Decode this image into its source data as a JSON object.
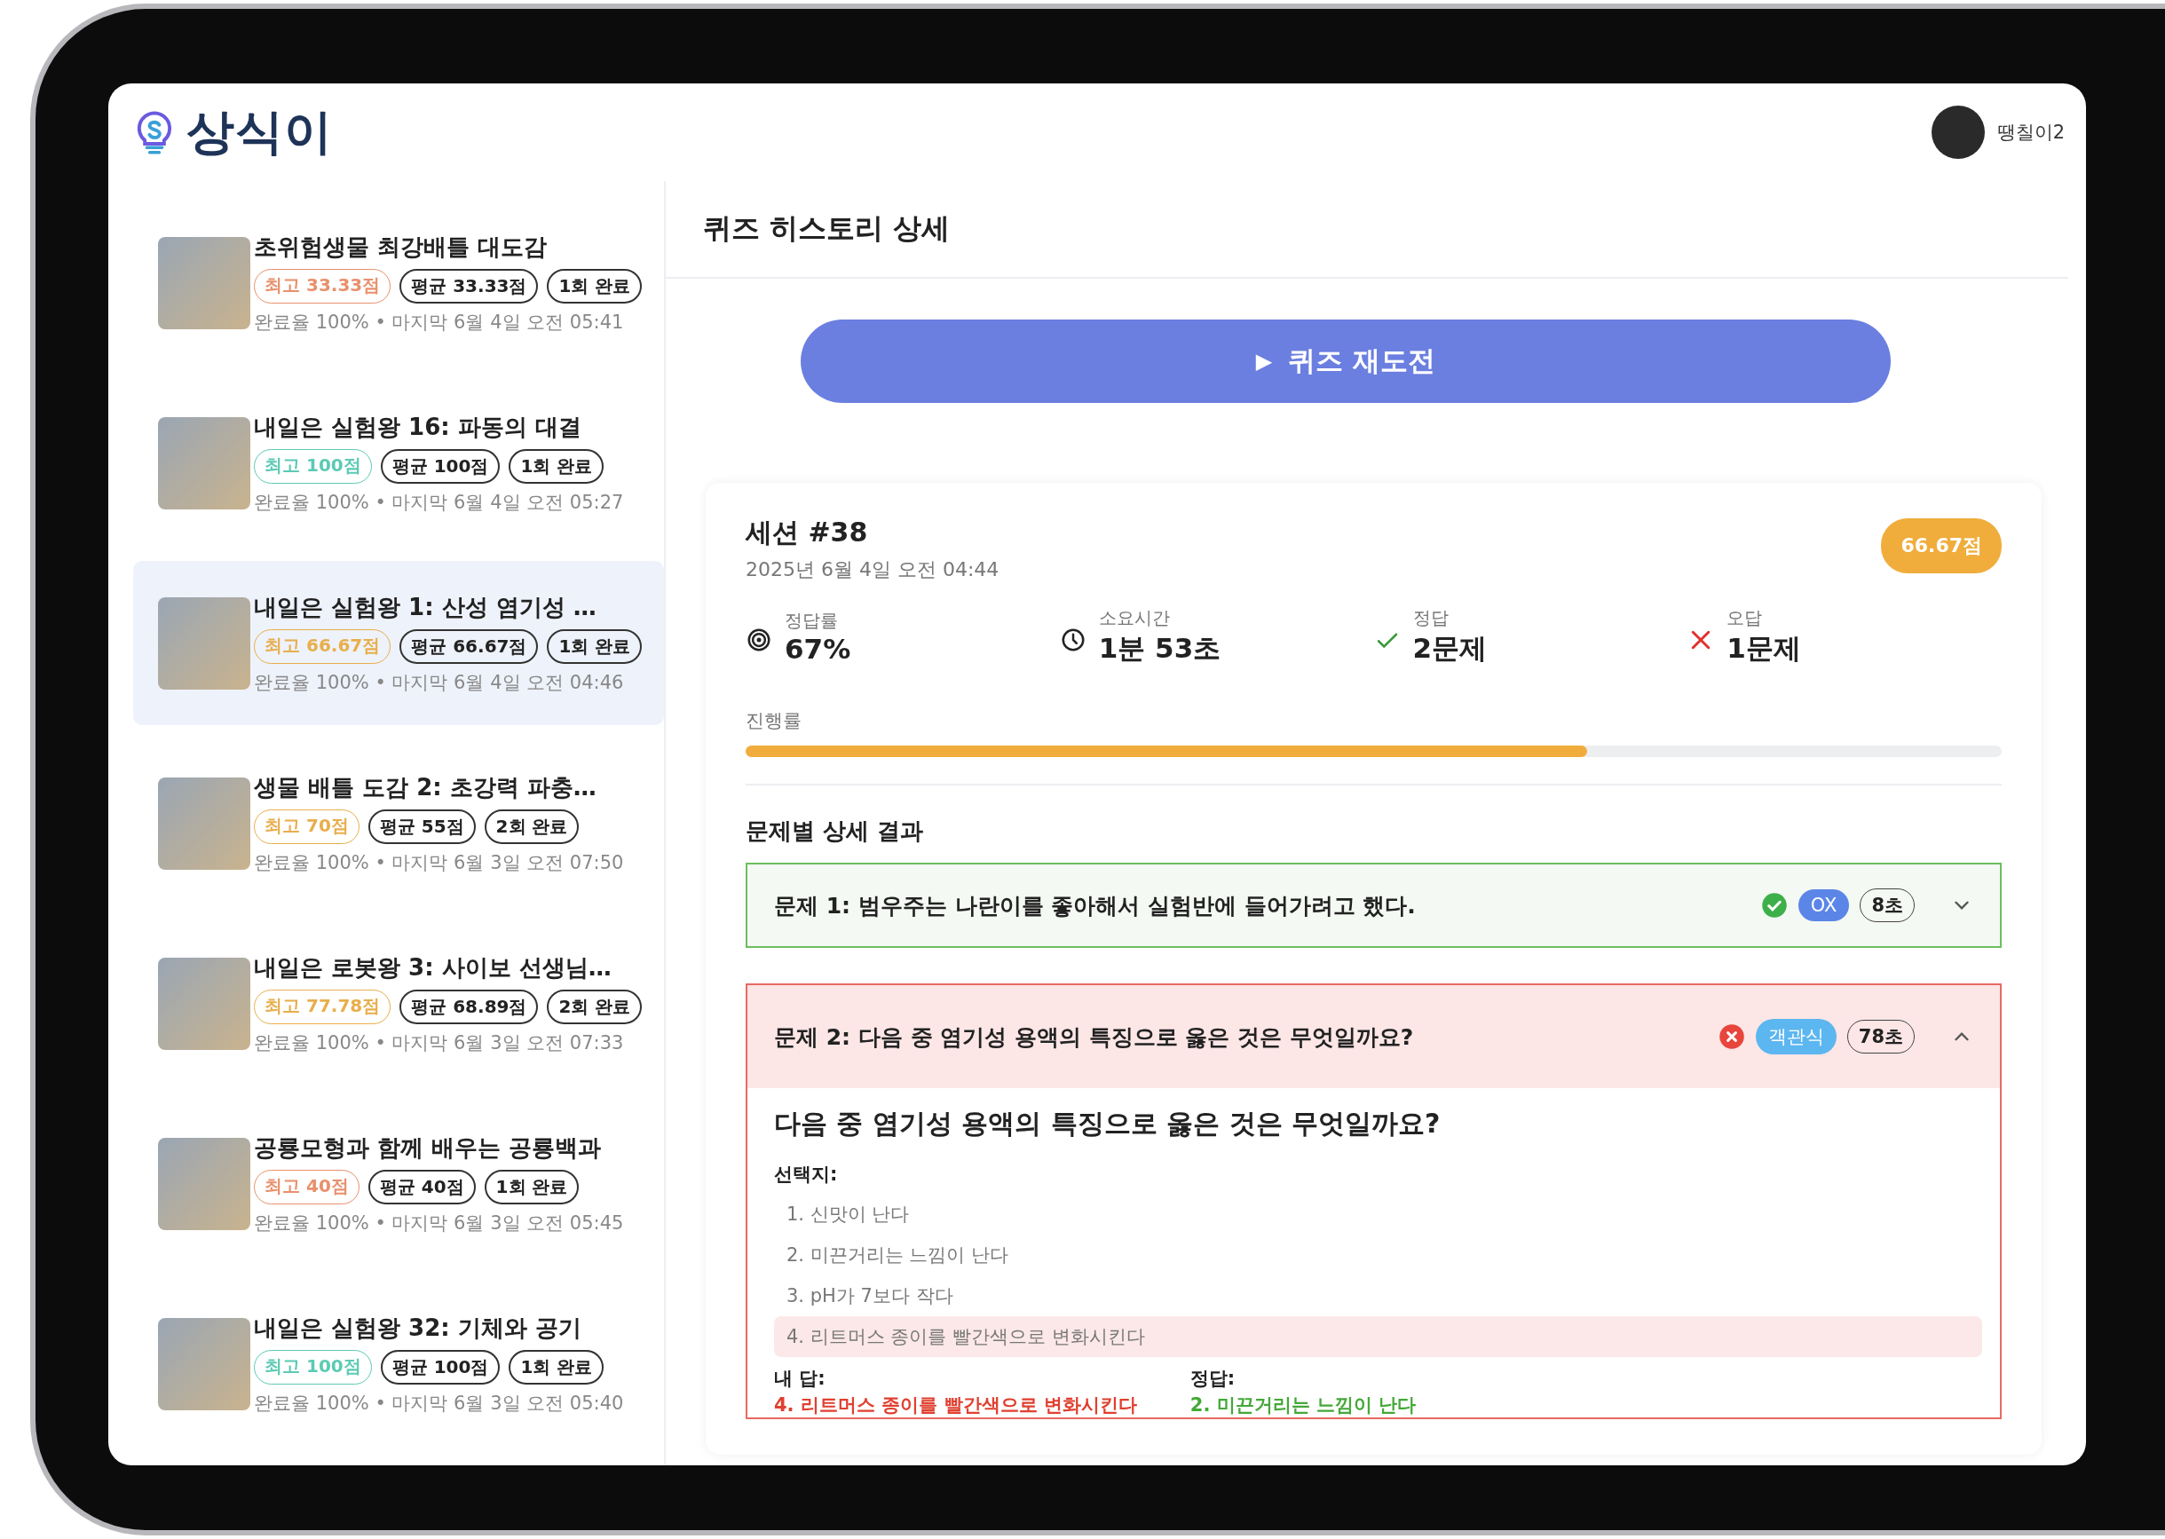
{
  "app": {
    "logo_text": "상식이",
    "user_name": "땡칠이2"
  },
  "sidebar": {
    "items": [
      {
        "title": "초위험생물 최강배틀 대도감",
        "best": {
          "text": "최고 33.33점",
          "color": "#e8906c"
        },
        "average": "평균 33.33점",
        "count": "1회 완료",
        "meta": "완료율 100% • 마지막 6월 4일 오전 05:41",
        "selected": false
      },
      {
        "title": "내일은 실험왕 16: 파동의 대결",
        "best": {
          "text": "최고 100점",
          "color": "#5ccab4"
        },
        "average": "평균 100점",
        "count": "1회 완료",
        "meta": "완료율 100% • 마지막 6월 4일 오전 05:27",
        "selected": false
      },
      {
        "title": "내일은 실험왕 1: 산성 염기성 …",
        "best": {
          "text": "최고 66.67점",
          "color": "#e8ae4c"
        },
        "average": "평균 66.67점",
        "count": "1회 완료",
        "meta": "완료율 100% • 마지막 6월 4일 오전 04:46",
        "selected": true
      },
      {
        "title": "생물 배틀 도감 2: 초강력 파충…",
        "best": {
          "text": "최고 70점",
          "color": "#e8ae4c"
        },
        "average": "평균 55점",
        "count": "2회 완료",
        "meta": "완료율 100% • 마지막 6월 3일 오전 07:50",
        "selected": false
      },
      {
        "title": "내일은 로봇왕 3: 사이보 선생님…",
        "best": {
          "text": "최고 77.78점",
          "color": "#e8ae4c"
        },
        "average": "평균 68.89점",
        "count": "2회 완료",
        "meta": "완료율 100% • 마지막 6월 3일 오전 07:33",
        "selected": false
      },
      {
        "title": "공룡모형과 함께 배우는 공룡백과",
        "best": {
          "text": "최고 40점",
          "color": "#e8906c"
        },
        "average": "평균 40점",
        "count": "1회 완료",
        "meta": "완료율 100% • 마지막 6월 3일 오전 05:45",
        "selected": false
      },
      {
        "title": "내일은 실험왕 32: 기체와 공기",
        "best": {
          "text": "최고 100점",
          "color": "#5ccab4"
        },
        "average": "평균 100점",
        "count": "1회 완료",
        "meta": "완료율 100% • 마지막 6월 3일 오전 05:40",
        "selected": false
      }
    ]
  },
  "main": {
    "title": "퀴즈 히스토리 상세",
    "retry_button": {
      "icon": "▶",
      "label": "퀴즈 재도전"
    },
    "session": {
      "title": "세션 #38",
      "date": "2025년 6월 4일 오전 04:44",
      "score": "66.67점",
      "stats": [
        {
          "kind": "accuracy",
          "label": "정답률",
          "value": "67%"
        },
        {
          "kind": "time",
          "label": "소요시간",
          "value": "1분 53초"
        },
        {
          "kind": "correct",
          "label": "정답",
          "value": "2문제"
        },
        {
          "kind": "wrong",
          "label": "오답",
          "value": "1문제"
        }
      ],
      "progress": {
        "label": "진행률",
        "level": 0.67
      },
      "results_title": "문제별 상세 결과",
      "questions": [
        {
          "title": "문제 1: 범우주는 나란이를 좋아해서 실험반에 들어가려고 했다.",
          "correct": true,
          "type": {
            "text": "OX",
            "color": "#5b86e8"
          },
          "time": "8초",
          "expanded": false
        },
        {
          "title": "문제 2: 다음 중 염기성 용액의 특징으로 옳은 것은 무엇일까요?",
          "correct": false,
          "type": {
            "text": "객관식",
            "color": "#5cb6f0"
          },
          "time": "78초",
          "expanded": true,
          "detail": {
            "question": "다음 중 염기성 용액의 특징으로 옳은 것은 무엇일까요?",
            "choices_label": "선택지:",
            "choices": [
              {
                "text": "1. 신맛이 난다",
                "selected": false
              },
              {
                "text": "2. 미끈거리는 느낌이 난다",
                "selected": false
              },
              {
                "text": "3. pH가 7보다 작다",
                "selected": false
              },
              {
                "text": "4. 리트머스 종이를 빨간색으로 변화시킨다",
                "selected": true
              }
            ],
            "my_answer_label": "내 답:",
            "my_answer": "4. 리트머스 종이를 빨간색으로 변화시킨다",
            "correct_label": "정답:",
            "correct_answer": "2. 미끈거리는 느낌이 난다"
          }
        }
      ]
    }
  }
}
